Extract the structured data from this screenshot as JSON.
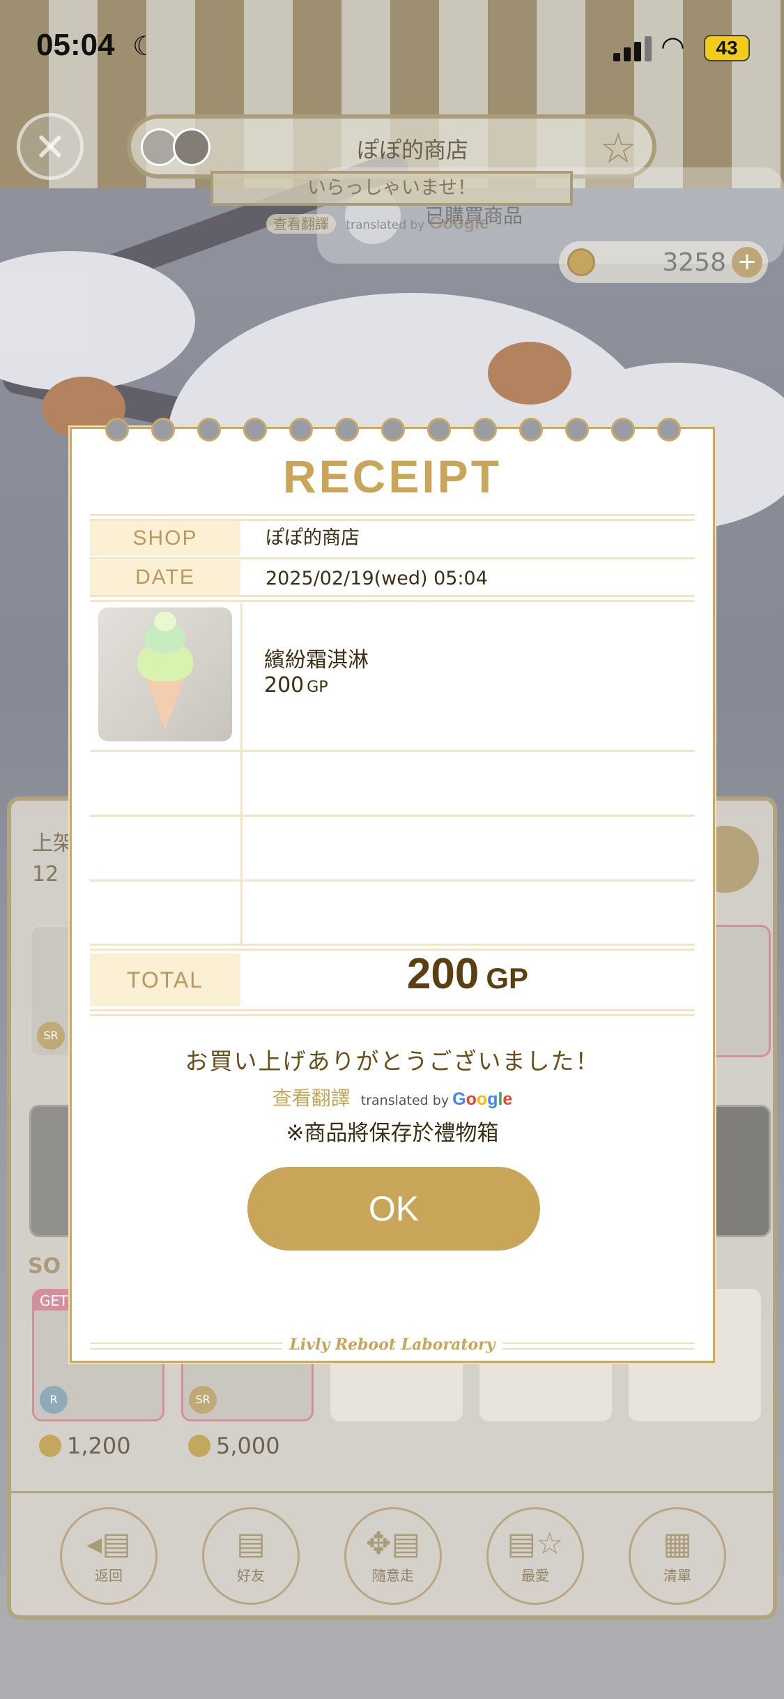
{
  "status_bar": {
    "time": "05:04",
    "battery": "43"
  },
  "shop_header": {
    "shop_name": "ぽぽ的商店",
    "welcome": "いらっしゃいませ！",
    "translate_link": "查看翻譯",
    "translated_by": "translated by",
    "google": "Google",
    "purchased_label": "已購買商品",
    "gp_balance": "3258"
  },
  "shop_panel": {
    "listed_label": "上架",
    "listed_count": "12",
    "section_label": "SO",
    "badge_get": "GET",
    "items": [
      {
        "rarity": "SR",
        "price": ""
      },
      {
        "rarity": "R",
        "price": "1,200"
      },
      {
        "rarity": "SR",
        "price": "5,000"
      }
    ],
    "nav": [
      {
        "label": "返回",
        "icon": "back-icon"
      },
      {
        "label": "好友",
        "icon": "friends-icon"
      },
      {
        "label": "隨意走",
        "icon": "random-walk-icon"
      },
      {
        "label": "最愛",
        "icon": "favorite-icon"
      },
      {
        "label": "清單",
        "icon": "list-icon"
      }
    ]
  },
  "receipt": {
    "title": "RECEIPT",
    "shop_label": "SHOP",
    "shop_value": "ぽぽ的商店",
    "date_label": "DATE",
    "date_value": "2025/02/19(wed) 05:04",
    "item": {
      "name": "繽紛霜淇淋",
      "price": "200",
      "unit": "GP",
      "icon": "ice-cream-icon"
    },
    "total_label": "TOTAL",
    "total_value": "200",
    "total_unit": "GP",
    "thanks": "お買い上げありがとうございました！",
    "translate_link": "查看翻譯",
    "translated_by": "translated by",
    "note": "※商品將保存於禮物箱",
    "ok_label": "OK",
    "footer_brand": "Livly Reboot Laboratory"
  },
  "colors": {
    "gold": "#c9a55a",
    "label_bg": "#fbefd4",
    "text_brown": "#3d2e12"
  }
}
